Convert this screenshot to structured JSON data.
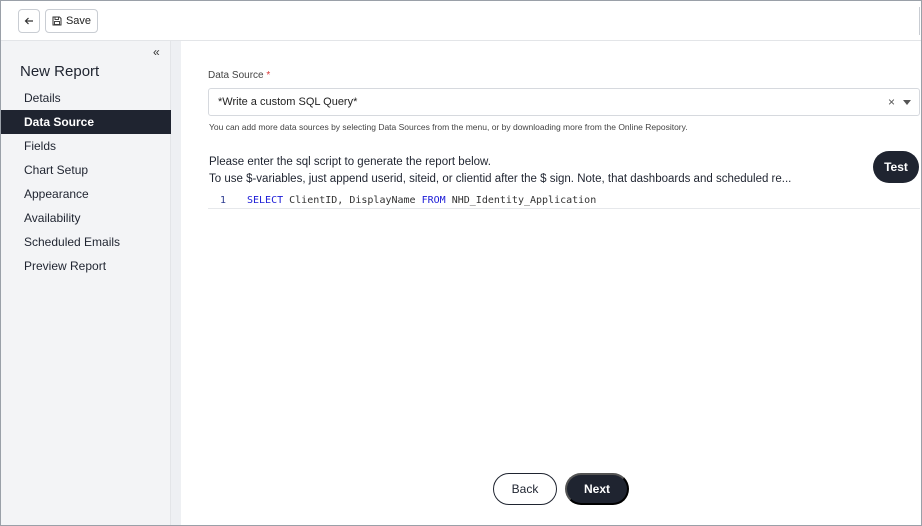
{
  "toolbar": {
    "back_icon": "arrow-left-icon",
    "save_icon": "floppy-disk-icon",
    "save_label": "Save"
  },
  "sidebar": {
    "collapse_icon": "double-chevron-left-icon",
    "collapse_glyph": "«",
    "title": "New Report",
    "items": [
      {
        "label": "Details",
        "active": false
      },
      {
        "label": "Data Source",
        "active": true
      },
      {
        "label": "Fields",
        "active": false
      },
      {
        "label": "Chart Setup",
        "active": false
      },
      {
        "label": "Appearance",
        "active": false
      },
      {
        "label": "Availability",
        "active": false
      },
      {
        "label": "Scheduled Emails",
        "active": false
      },
      {
        "label": "Preview Report",
        "active": false
      }
    ]
  },
  "main": {
    "data_source": {
      "label": "Data Source",
      "required_mark": "*",
      "selected_value": "*Write a custom SQL Query*",
      "clear_glyph": "×",
      "help_text": "You can add more data sources by selecting Data Sources from the menu, or by downloading more from the Online Repository."
    },
    "instructions": {
      "line1": "Please enter the sql script to generate the report below.",
      "line2": "To use $-variables, just append userid, siteid, or clientid after the $ sign. Note, that dashboards and scheduled re..."
    },
    "test_label": "Test",
    "editor": {
      "line_number": "1",
      "kw_select": "SELECT",
      "part1": " ClientID, DisplayName ",
      "kw_from": "FROM",
      "part2": " NHD_Identity_Application"
    },
    "back_label": "Back",
    "next_label": "Next"
  },
  "colors": {
    "primary": "#1f2430",
    "sidebar_bg": "#f3f4f6",
    "required": "#d93636",
    "sql_keyword": "#1a1ad6"
  }
}
